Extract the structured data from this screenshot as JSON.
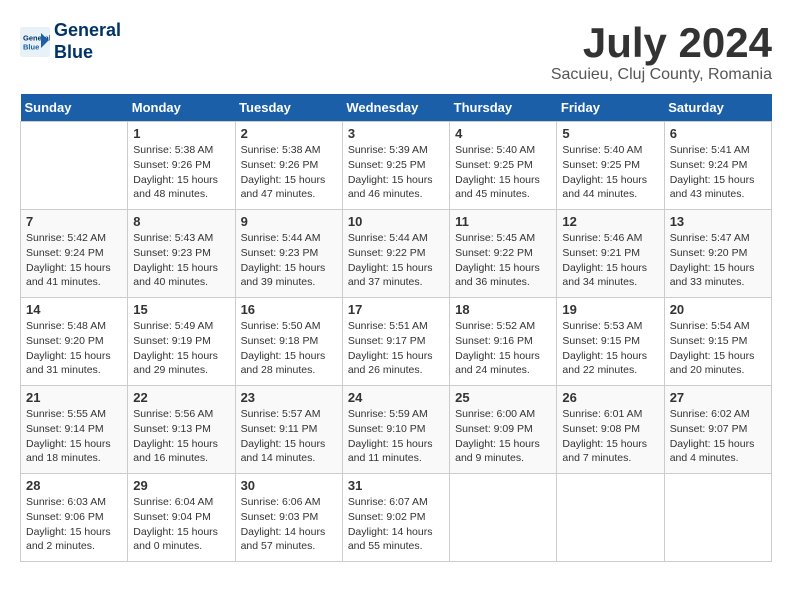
{
  "header": {
    "logo_line1": "General",
    "logo_line2": "Blue",
    "month": "July 2024",
    "location": "Sacuieu, Cluj County, Romania"
  },
  "days_of_week": [
    "Sunday",
    "Monday",
    "Tuesday",
    "Wednesday",
    "Thursday",
    "Friday",
    "Saturday"
  ],
  "weeks": [
    [
      {
        "day": "",
        "info": ""
      },
      {
        "day": "1",
        "info": "Sunrise: 5:38 AM\nSunset: 9:26 PM\nDaylight: 15 hours\nand 48 minutes."
      },
      {
        "day": "2",
        "info": "Sunrise: 5:38 AM\nSunset: 9:26 PM\nDaylight: 15 hours\nand 47 minutes."
      },
      {
        "day": "3",
        "info": "Sunrise: 5:39 AM\nSunset: 9:25 PM\nDaylight: 15 hours\nand 46 minutes."
      },
      {
        "day": "4",
        "info": "Sunrise: 5:40 AM\nSunset: 9:25 PM\nDaylight: 15 hours\nand 45 minutes."
      },
      {
        "day": "5",
        "info": "Sunrise: 5:40 AM\nSunset: 9:25 PM\nDaylight: 15 hours\nand 44 minutes."
      },
      {
        "day": "6",
        "info": "Sunrise: 5:41 AM\nSunset: 9:24 PM\nDaylight: 15 hours\nand 43 minutes."
      }
    ],
    [
      {
        "day": "7",
        "info": "Sunrise: 5:42 AM\nSunset: 9:24 PM\nDaylight: 15 hours\nand 41 minutes."
      },
      {
        "day": "8",
        "info": "Sunrise: 5:43 AM\nSunset: 9:23 PM\nDaylight: 15 hours\nand 40 minutes."
      },
      {
        "day": "9",
        "info": "Sunrise: 5:44 AM\nSunset: 9:23 PM\nDaylight: 15 hours\nand 39 minutes."
      },
      {
        "day": "10",
        "info": "Sunrise: 5:44 AM\nSunset: 9:22 PM\nDaylight: 15 hours\nand 37 minutes."
      },
      {
        "day": "11",
        "info": "Sunrise: 5:45 AM\nSunset: 9:22 PM\nDaylight: 15 hours\nand 36 minutes."
      },
      {
        "day": "12",
        "info": "Sunrise: 5:46 AM\nSunset: 9:21 PM\nDaylight: 15 hours\nand 34 minutes."
      },
      {
        "day": "13",
        "info": "Sunrise: 5:47 AM\nSunset: 9:20 PM\nDaylight: 15 hours\nand 33 minutes."
      }
    ],
    [
      {
        "day": "14",
        "info": "Sunrise: 5:48 AM\nSunset: 9:20 PM\nDaylight: 15 hours\nand 31 minutes."
      },
      {
        "day": "15",
        "info": "Sunrise: 5:49 AM\nSunset: 9:19 PM\nDaylight: 15 hours\nand 29 minutes."
      },
      {
        "day": "16",
        "info": "Sunrise: 5:50 AM\nSunset: 9:18 PM\nDaylight: 15 hours\nand 28 minutes."
      },
      {
        "day": "17",
        "info": "Sunrise: 5:51 AM\nSunset: 9:17 PM\nDaylight: 15 hours\nand 26 minutes."
      },
      {
        "day": "18",
        "info": "Sunrise: 5:52 AM\nSunset: 9:16 PM\nDaylight: 15 hours\nand 24 minutes."
      },
      {
        "day": "19",
        "info": "Sunrise: 5:53 AM\nSunset: 9:15 PM\nDaylight: 15 hours\nand 22 minutes."
      },
      {
        "day": "20",
        "info": "Sunrise: 5:54 AM\nSunset: 9:15 PM\nDaylight: 15 hours\nand 20 minutes."
      }
    ],
    [
      {
        "day": "21",
        "info": "Sunrise: 5:55 AM\nSunset: 9:14 PM\nDaylight: 15 hours\nand 18 minutes."
      },
      {
        "day": "22",
        "info": "Sunrise: 5:56 AM\nSunset: 9:13 PM\nDaylight: 15 hours\nand 16 minutes."
      },
      {
        "day": "23",
        "info": "Sunrise: 5:57 AM\nSunset: 9:11 PM\nDaylight: 15 hours\nand 14 minutes."
      },
      {
        "day": "24",
        "info": "Sunrise: 5:59 AM\nSunset: 9:10 PM\nDaylight: 15 hours\nand 11 minutes."
      },
      {
        "day": "25",
        "info": "Sunrise: 6:00 AM\nSunset: 9:09 PM\nDaylight: 15 hours\nand 9 minutes."
      },
      {
        "day": "26",
        "info": "Sunrise: 6:01 AM\nSunset: 9:08 PM\nDaylight: 15 hours\nand 7 minutes."
      },
      {
        "day": "27",
        "info": "Sunrise: 6:02 AM\nSunset: 9:07 PM\nDaylight: 15 hours\nand 4 minutes."
      }
    ],
    [
      {
        "day": "28",
        "info": "Sunrise: 6:03 AM\nSunset: 9:06 PM\nDaylight: 15 hours\nand 2 minutes."
      },
      {
        "day": "29",
        "info": "Sunrise: 6:04 AM\nSunset: 9:04 PM\nDaylight: 15 hours\nand 0 minutes."
      },
      {
        "day": "30",
        "info": "Sunrise: 6:06 AM\nSunset: 9:03 PM\nDaylight: 14 hours\nand 57 minutes."
      },
      {
        "day": "31",
        "info": "Sunrise: 6:07 AM\nSunset: 9:02 PM\nDaylight: 14 hours\nand 55 minutes."
      },
      {
        "day": "",
        "info": ""
      },
      {
        "day": "",
        "info": ""
      },
      {
        "day": "",
        "info": ""
      }
    ]
  ]
}
